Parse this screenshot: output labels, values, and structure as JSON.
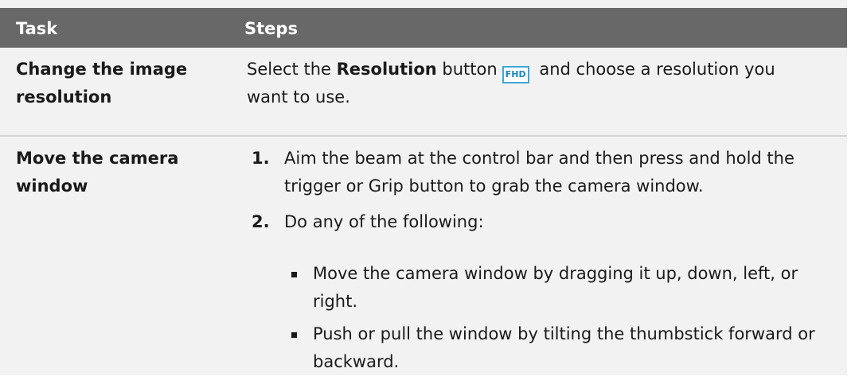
{
  "table": {
    "headers": {
      "task": "Task",
      "steps": "Steps"
    },
    "row1": {
      "task": "Change the image resolution",
      "steps_prefix": "Select the ",
      "steps_bold": "Resolution",
      "steps_mid": " button",
      "icon_label": "FHD",
      "steps_suffix": " and choose a resolution you want to use."
    },
    "row2": {
      "task": "Move the camera window",
      "step1_num": "1.",
      "step1": "Aim the beam at the control bar and then press and hold the trigger or Grip button to grab the camera window.",
      "step2_num": "2.",
      "step2": "Do any of the following:",
      "bullets": [
        "Move the camera window by dragging it up, down, left, or right.",
        "Push or pull the window by tilting the thumbstick forward or backward."
      ]
    }
  },
  "colors": {
    "header_bg": "#686868",
    "row_bg": "#f2f2f2",
    "icon_border": "#3fa7d9"
  }
}
